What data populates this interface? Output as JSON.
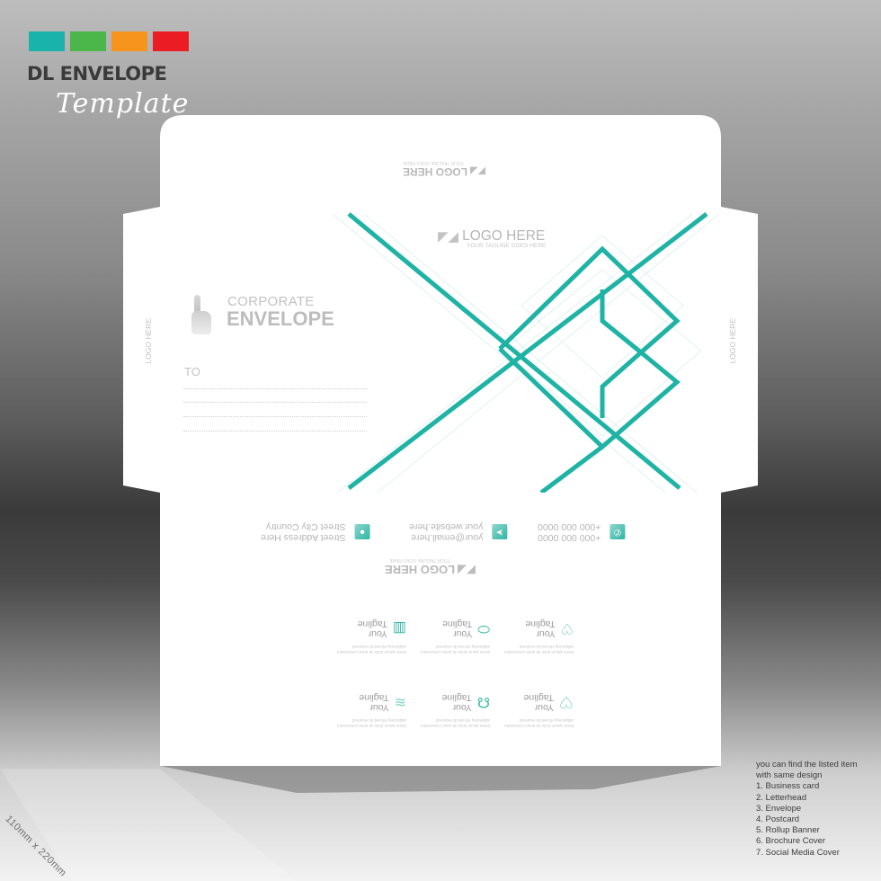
{
  "brand": {
    "swatch_colors": [
      "#1ab3ab",
      "#4bb64a",
      "#f7941d",
      "#ec1c24"
    ],
    "title": "DL ENVELOPE",
    "script_subtitle": "Template"
  },
  "accent_color": "#1fb3a5",
  "envelope": {
    "top_flap_logo": {
      "name": "LOGO HERE",
      "tagline": "YOUR TAGLINE GOES HERE"
    },
    "front_logo": {
      "name": "LOGO HERE",
      "tagline": "YOUR TAGLINE GOES HERE"
    },
    "side_logo_left": {
      "name": "LOGO HERE"
    },
    "side_logo_right": {
      "name": "LOGO HERE"
    },
    "heading_light": "CORPORATE",
    "heading_bold": "ENVELOPE",
    "to_label": "TO",
    "contact": {
      "address": [
        "Street Address Here",
        "Street City Country"
      ],
      "web": [
        "your@email.here",
        "your.website.here"
      ],
      "phone": [
        "+000 000 0000",
        "+000 000 0000"
      ]
    },
    "bottom_logo": {
      "name": "LOGO HERE",
      "tagline": "YOUR TAGLINE GOES HERE"
    },
    "features": [
      {
        "icon": "hand-heart-icon",
        "title": [
          "Your",
          "Tagline"
        ],
        "desc": "lorem ipsum dolor sit amet consectetur adipiscing elit sed do eiusmod"
      },
      {
        "icon": "pill-icon",
        "title": [
          "Your",
          "Tagline"
        ],
        "desc": "lorem ipsum dolor sit amet consectetur adipiscing elit sed do eiusmod"
      },
      {
        "icon": "hospital-bag-icon",
        "title": [
          "Your",
          "Tagline"
        ],
        "desc": "lorem ipsum dolor sit amet consectetur adipiscing elit sed do eiusmod"
      },
      {
        "icon": "heart-icon",
        "title": [
          "Your",
          "Tagline"
        ],
        "desc": "lorem ipsum dolor sit amet consectetur adipiscing elit sed do eiusmod"
      },
      {
        "icon": "stethoscope-icon",
        "title": [
          "Your",
          "Tagline"
        ],
        "desc": "lorem ipsum dolor sit amet consectetur adipiscing elit sed do eiusmod"
      },
      {
        "icon": "layers-icon",
        "title": [
          "Your",
          "Tagline"
        ],
        "desc": "lorem ipsum dolor sit amet consectetur adipiscing elit sed do eiusmod"
      }
    ]
  },
  "size_label": "110mm x 220mm",
  "items_note": {
    "intro": [
      "you can find the listed item",
      "with same design"
    ],
    "items": [
      "1. Business card",
      "2. Letterhead",
      "3. Envelope",
      "4. Postcard",
      "5. Rollup Banner",
      "6. Brochure Cover",
      "7. Social Media Cover"
    ]
  }
}
